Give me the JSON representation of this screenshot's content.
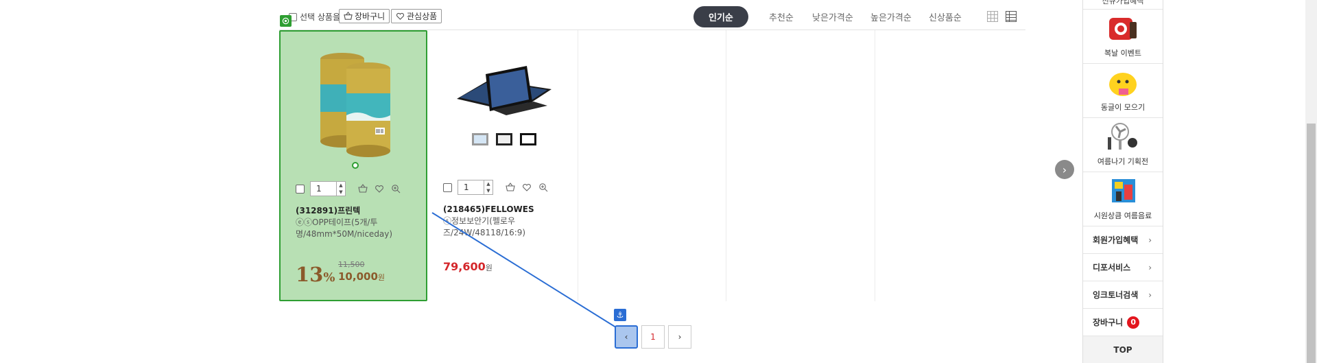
{
  "toolbar": {
    "select_label": "선택 상품을",
    "cart_btn": "장바구니",
    "wish_btn": "관심상품"
  },
  "sort": {
    "items": [
      "인기순",
      "추천순",
      "낮은가격순",
      "높은가격순",
      "신상품순"
    ],
    "active": "인기순"
  },
  "products": [
    {
      "qty": "1",
      "code": "(312891)프린텍",
      "desc": "ⓔⓢOPP테이프(5개/투명/48mm*50M/niceday)",
      "discount": "13",
      "discount_unit": "%",
      "original_price": "11,500",
      "price": "10,000",
      "price_unit": "원"
    },
    {
      "qty": "1",
      "code": "(218465)FELLOWES",
      "desc": "ⓢ정보보안기(펠로우즈/24W/48118/16:9)",
      "price": "79,600",
      "price_unit": "원"
    }
  ],
  "pagination": {
    "prev": "‹",
    "current": "1",
    "next": "›"
  },
  "sidebar": {
    "top_partial": "신규가입혜택",
    "promos": [
      {
        "label": "복날 이벤트",
        "icon": "gift-box-icon"
      },
      {
        "label": "동글이 모으기",
        "icon": "yellow-mascot-icon"
      },
      {
        "label": "여름나기 기획전",
        "icon": "electric-fan-icon"
      },
      {
        "label": "시원상큼 여름음료",
        "icon": "drink-box-icon"
      }
    ],
    "links": [
      {
        "label": "회원가입혜택"
      },
      {
        "label": "디포서비스"
      },
      {
        "label": "잉크토너검색"
      }
    ],
    "cart_label": "장바구니",
    "cart_count": "0",
    "top_btn": "TOP"
  },
  "colors": {
    "highlight_fill": "#b8e0b4",
    "highlight_border": "#2e9e32",
    "price_red": "#d4272b",
    "discount_brown": "#8b5a2b",
    "active_sort_bg": "#3a3e48",
    "anchor_blue": "#2a6dd4"
  }
}
